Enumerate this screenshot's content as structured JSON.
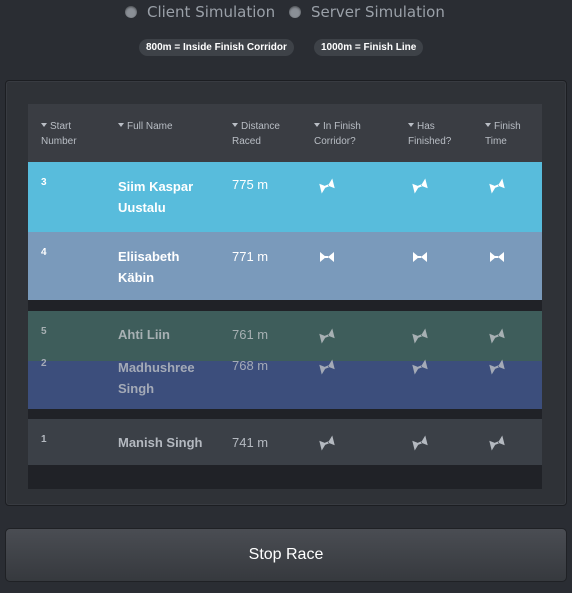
{
  "simulation_modes": [
    {
      "label": "Client Simulation"
    },
    {
      "label": "Server Simulation"
    }
  ],
  "legend_badges": [
    {
      "label": "800m = Inside Finish Corridor"
    },
    {
      "label": "1000m = Finish Line"
    }
  ],
  "table": {
    "columns": [
      {
        "line1": "Start",
        "line2": "Number"
      },
      {
        "line1": "Full Name",
        "line2": ""
      },
      {
        "line1": "Distance",
        "line2": "Raced"
      },
      {
        "line1": "In Finish",
        "line2": "Corridor?"
      },
      {
        "line1": "Has",
        "line2": "Finished?"
      },
      {
        "line1": "Finish",
        "line2": "Time"
      }
    ],
    "rows": [
      {
        "start": "3",
        "name": "Siim Kaspar Uustalu",
        "distance": "775 m",
        "row_color": "#58bcdc",
        "text_color": "#ffffff",
        "flag_color": "#ffffff",
        "flag_icon": "hourglass-tilted-icon"
      },
      {
        "start": "4",
        "name": "Eliisabeth Käbin",
        "distance": "771 m",
        "row_color": "#7a9abb",
        "text_color": "#ffffff",
        "flag_color": "#ffffff",
        "flag_icon": "hourglass-icon"
      },
      {
        "start": "5",
        "name": "Ahti Liin",
        "distance": "761 m",
        "row_color": "#3e5d5b",
        "text_color": "#a7b0b3",
        "flag_color": "#a7b0b3",
        "flag_icon": "hourglass-tilted-icon"
      },
      {
        "start": "2",
        "name": "Madhushree Singh",
        "distance": "768 m",
        "row_color": "#3c4e7c",
        "text_color": "#a4aab7",
        "flag_color": "#a4aab7",
        "flag_icon": "hourglass-tilted-icon"
      },
      {
        "start": "1",
        "name": "Manish Singh",
        "distance": "741 m",
        "row_color": "#3b4047",
        "text_color": "#b4b9c0",
        "flag_color": "#b4b9c0",
        "flag_icon": "hourglass-tilted-icon"
      }
    ]
  },
  "stop_button": {
    "label": "Stop Race"
  }
}
